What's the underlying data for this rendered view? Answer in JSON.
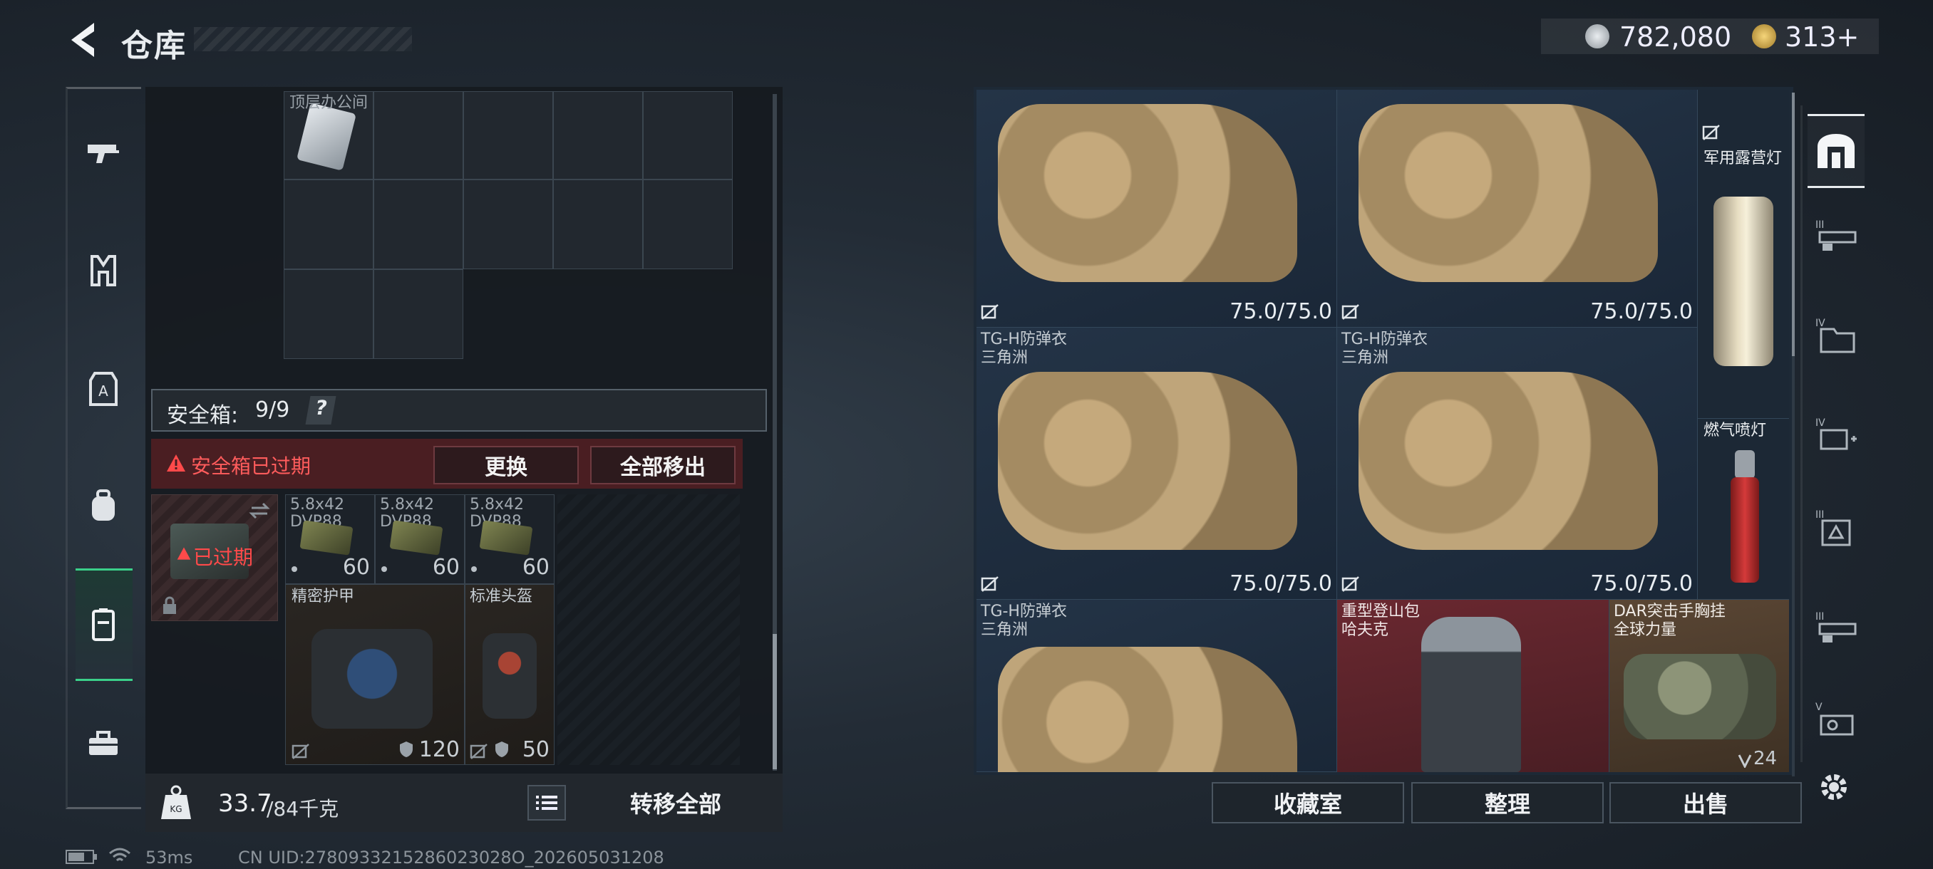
{
  "header": {
    "title": "仓库"
  },
  "currency": {
    "silver": "782,080",
    "gold": "313+"
  },
  "left": {
    "container_label": "顶层办公间",
    "safe_box": {
      "label": "安全箱:",
      "value": "9/9",
      "help": "?"
    },
    "alert": {
      "text": "安全箱已过期",
      "replace": "更换",
      "remove_all": "全部移出"
    },
    "expired_badge": "已过期",
    "ammo": [
      {
        "name_line1": "5.8x42",
        "name_line2": "DVP88",
        "count": "60"
      },
      {
        "name_line1": "5.8x42",
        "name_line2": "DVP88",
        "count": "60"
      },
      {
        "name_line1": "5.8x42",
        "name_line2": "DVP88",
        "count": "60"
      }
    ],
    "gear": [
      {
        "name": "精密护甲",
        "durability": "120"
      },
      {
        "name": "标准头盔",
        "durability": "50"
      }
    ],
    "weight": {
      "current": "33.7",
      "max": "/84千克"
    },
    "transfer_all": "转移全部"
  },
  "right": {
    "vests": [
      {
        "name": "",
        "sub": "",
        "durability": "75.0/75.0"
      },
      {
        "name": "",
        "sub": "",
        "durability": "75.0/75.0"
      },
      {
        "name": "TG-H防弹衣",
        "sub": "三角洲",
        "durability": "75.0/75.0"
      },
      {
        "name": "TG-H防弹衣",
        "sub": "三角洲",
        "durability": "75.0/75.0"
      },
      {
        "name": "TG-H防弹衣",
        "sub": "三角洲",
        "durability": ""
      }
    ],
    "side_items": [
      {
        "name": "军用露营灯"
      },
      {
        "name": "燃气喷灯"
      }
    ],
    "backpack": {
      "name": "重型登山包",
      "sub": "哈夫克"
    },
    "rig": {
      "name": "DAR突击手胸挂",
      "sub": "全球力量",
      "count": "24"
    },
    "buttons": {
      "collection": "收藏室",
      "sort": "整理",
      "sell": "出售"
    }
  },
  "status": {
    "ping": "53ms",
    "uid": "CN UID:2780933215286023028O_202605031208"
  },
  "colors": {
    "accent_green": "#3bd08a",
    "alert_red": "#e84a4a",
    "backpack_bg": "#5a2228",
    "rig_bg": "#4a3a2c"
  }
}
